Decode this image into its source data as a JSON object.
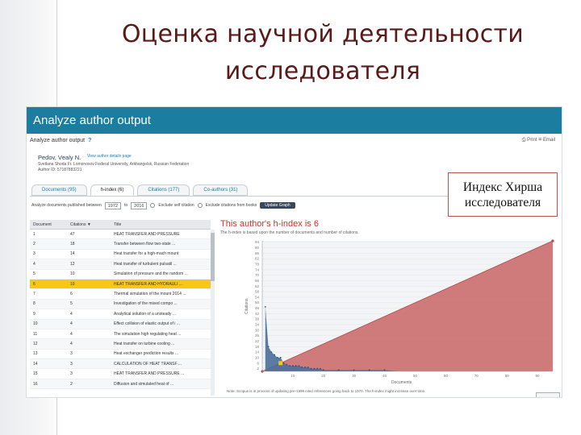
{
  "slide": {
    "title_line1": "Оценка научной деятельности",
    "title_line2": "исследователя"
  },
  "app": {
    "header": "Analyze author output",
    "subheader": "Analyze author output",
    "tools": "⎙ Print  ✉ Email",
    "author_name": "Pеdоv, Vеаlу N.",
    "author_link": "View author details page",
    "author_meta_1": "Svetlana Shoda Fr. Lomonosov Federal University, Arkhangelsk, Russian Federation",
    "author_meta_2": "Author ID: 57187883221"
  },
  "tabs": [
    {
      "label": "Documents (95)",
      "active": false
    },
    {
      "label": "h-index (6)",
      "active": true
    },
    {
      "label": "Citations (177)",
      "active": false
    },
    {
      "label": "Co-authors (31)",
      "active": false
    }
  ],
  "filter": {
    "label": "Analyze documents published between",
    "from": "1972",
    "to_label": "to",
    "to": "2016",
    "radio1": "Exclude self citation",
    "radio2": "Exclude citations from books",
    "button": "Update Graph"
  },
  "table": {
    "headers": [
      "Document",
      "Citations ▼",
      "Title"
    ],
    "rows": [
      {
        "doc": "1",
        "cit": "47",
        "title": "HEAT TRANSFER AND PRESSURE",
        "hl": false
      },
      {
        "doc": "2",
        "cit": "18",
        "title": "Transfer between flow two-state ...",
        "hl": false
      },
      {
        "doc": "3",
        "cit": "14",
        "title": "Heat transfer for a high-mach mount",
        "hl": false
      },
      {
        "doc": "4",
        "cit": "12",
        "title": "Heat transfer of turbulent pulsatil ...",
        "hl": false
      },
      {
        "doc": "5",
        "cit": "10",
        "title": "Simulation of pressure and the random ...",
        "hl": false
      },
      {
        "doc": "6",
        "cit": "10",
        "title": "HEAT TRANSFER AND HYDRAULI ...",
        "hl": true
      },
      {
        "doc": "7",
        "cit": "6",
        "title": "Thermal simulation of the mount 2014 ...",
        "hl": false
      },
      {
        "doc": "8",
        "cit": "5",
        "title": "Investigation of the mixed compo ...",
        "hl": false
      },
      {
        "doc": "9",
        "cit": "4",
        "title": "Analytical solution of a unsteady ...",
        "hl": false
      },
      {
        "doc": "10",
        "cit": "4",
        "title": "Effect collision of elastic output of i ...",
        "hl": false
      },
      {
        "doc": "11",
        "cit": "4",
        "title": "The simulation high regulating heat ...",
        "hl": false
      },
      {
        "doc": "12",
        "cit": "4",
        "title": "Heat transfer on turbine cooling ...",
        "hl": false
      },
      {
        "doc": "13",
        "cit": "3",
        "title": "Heat exchanger prediction results ...",
        "hl": false
      },
      {
        "doc": "14",
        "cit": "3",
        "title": "CALCULATION OF HEAT TRANSF ...",
        "hl": false
      },
      {
        "doc": "15",
        "cit": "3",
        "title": "HEAT TRANSFER AND PRESSURE ...",
        "hl": false
      },
      {
        "doc": "16",
        "cit": "2",
        "title": "Diffusion and simulated heat of ...",
        "hl": false
      }
    ]
  },
  "chart_heading": "This author's h-index is 6",
  "chart_subheading": "The h-index is based upon the number of documents and number of citations.",
  "footnote": "Note: Scopus is in process of updating pre-1996 cited references going back to 1970. The h-index might increase over time.",
  "callout": {
    "line1": "Индекс Хирша",
    "line2": "исследователя"
  },
  "colors": {
    "header_bg": "#1b7ea1",
    "title_text": "#5a1a1a",
    "triangle_fill": "#c96565",
    "bars_fill": "#4a6f99",
    "highlight_row": "#f7c618",
    "h_point": "#f7c618",
    "heading_red": "#d03030"
  },
  "chart_data": {
    "type": "area",
    "title": "This author's h-index is 6",
    "xlabel": "Documents",
    "ylabel": "Citations",
    "xlim": [
      0,
      95
    ],
    "ylim": [
      0,
      95
    ],
    "x_ticks": [
      "10",
      "20",
      "30",
      "40",
      "50",
      "60",
      "70",
      "80",
      "90"
    ],
    "y_ticks": [
      "2",
      "6",
      "10",
      "14",
      "18",
      "22",
      "26",
      "30",
      "34",
      "38",
      "42",
      "46",
      "50",
      "54",
      "58",
      "62",
      "66",
      "70",
      "74",
      "78",
      "82",
      "86",
      "90",
      "94"
    ],
    "series": [
      {
        "name": "",
        "type": "line",
        "x": [
          0,
          95
        ],
        "y": [
          0,
          95
        ]
      },
      {
        "name": "",
        "type": "area",
        "x": [
          1,
          2,
          3,
          4,
          5,
          6,
          7,
          8,
          9,
          10,
          11,
          12,
          13,
          14,
          15,
          16,
          17,
          18,
          19,
          20,
          25,
          30,
          35,
          40,
          45,
          50,
          60,
          70,
          80,
          90,
          95
        ],
        "y": [
          47,
          18,
          14,
          12,
          10,
          10,
          6,
          5,
          4,
          4,
          4,
          4,
          3,
          3,
          3,
          2,
          2,
          2,
          2,
          1,
          1,
          1,
          1,
          1,
          0,
          0,
          0,
          0,
          0,
          0,
          0
        ]
      }
    ],
    "h_index_point": {
      "x": 6,
      "y": 6
    }
  }
}
